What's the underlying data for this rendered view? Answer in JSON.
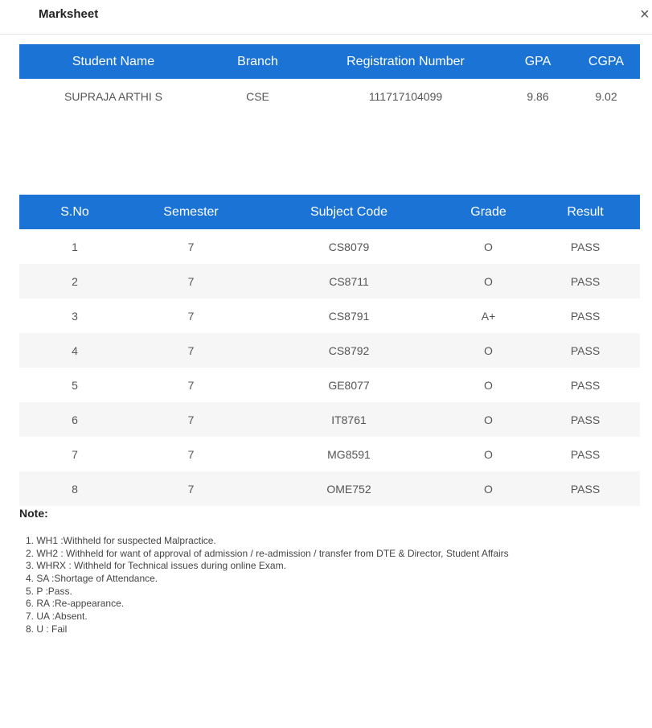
{
  "modal": {
    "title": "Marksheet",
    "close_icon": "×"
  },
  "summary": {
    "headers": [
      "Student Name",
      "Branch",
      "Registration Number",
      "GPA",
      "CGPA"
    ],
    "row": [
      "SUPRAJA ARTHI S",
      "CSE",
      "111717104099",
      "9.86",
      "9.02"
    ]
  },
  "marks": {
    "headers": [
      "S.No",
      "Semester",
      "Subject Code",
      "Grade",
      "Result"
    ],
    "rows": [
      [
        "1",
        "7",
        "CS8079",
        "O",
        "PASS"
      ],
      [
        "2",
        "7",
        "CS8711",
        "O",
        "PASS"
      ],
      [
        "3",
        "7",
        "CS8791",
        "A+",
        "PASS"
      ],
      [
        "4",
        "7",
        "CS8792",
        "O",
        "PASS"
      ],
      [
        "5",
        "7",
        "GE8077",
        "O",
        "PASS"
      ],
      [
        "6",
        "7",
        "IT8761",
        "O",
        "PASS"
      ],
      [
        "7",
        "7",
        "MG8591",
        "O",
        "PASS"
      ],
      [
        "8",
        "7",
        "OME752",
        "O",
        "PASS"
      ]
    ]
  },
  "notes": {
    "title": "Note:",
    "items": [
      "1. WH1 :Withheld for suspected Malpractice.",
      "2. WH2 : Withheld for want of approval of admission / re-admission / transfer from DTE & Director, Student Affairs",
      "3. WHRX : Withheld for Technical issues during online Exam.",
      "4. SA :Shortage of Attendance.",
      "5. P :Pass.",
      "6. RA :Re-appearance.",
      "7. UA :Absent.",
      "8. U : Fail"
    ]
  },
  "colors": {
    "header_bg": "#1b74d5",
    "header_text": "#ffffff",
    "stripe_bg": "#f6f6f6"
  }
}
